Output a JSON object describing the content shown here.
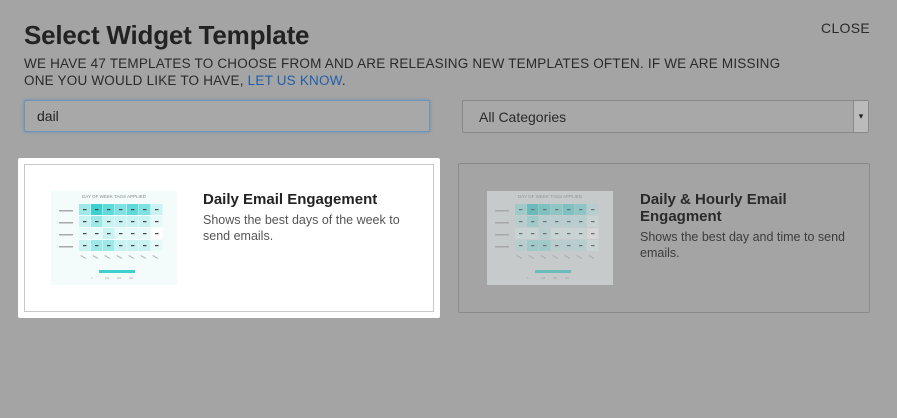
{
  "dialog": {
    "title": "Select Widget Template",
    "close_label": "CLOSE",
    "description": "WE HAVE 47 TEMPLATES TO CHOOSE FROM AND ARE RELEASING NEW TEMPLATES OFTEN. IF WE ARE MISSING ONE YOU WOULD LIKE TO HAVE,",
    "description_link": "LET US KNOW",
    "description_end": "."
  },
  "search": {
    "value": "dail"
  },
  "category_select": {
    "selected": "All Categories"
  },
  "templates": [
    {
      "title": "Daily Email Engagement",
      "description": "Shows the best days of the week to send emails.",
      "thumb_title": "DAY OF WEEK TAGS APPLIED"
    },
    {
      "title": "Daily & Hourly Email Engagment",
      "description": "Shows the best day and time to send emails.",
      "thumb_title": "DAY OF WEEK TAGS APPLIED"
    }
  ],
  "colors": {
    "overlay": "#a4a4a4",
    "link": "#1f5fa8",
    "heat_strong": "#3ecfcf",
    "heat_light": "#c9f2f2"
  }
}
